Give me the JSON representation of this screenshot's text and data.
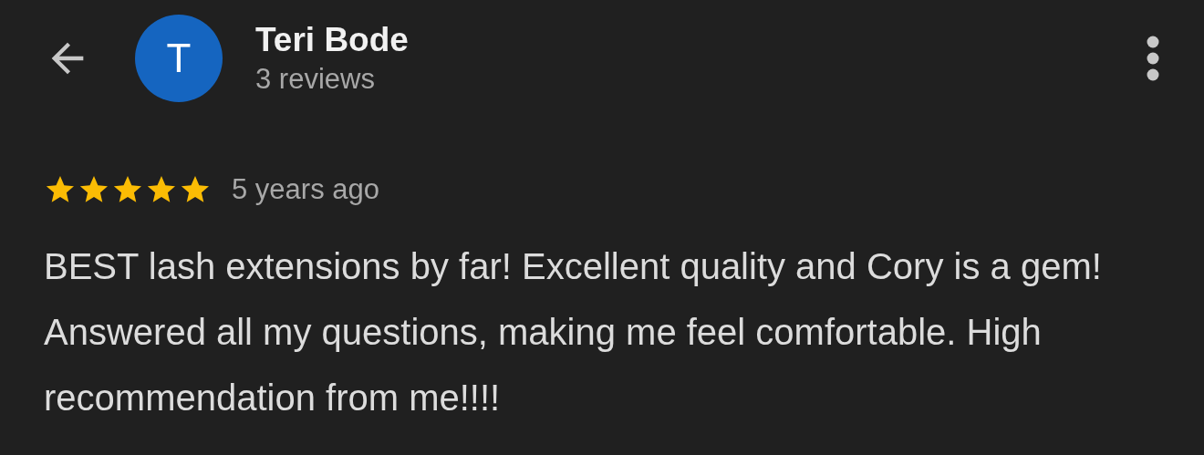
{
  "header": {
    "avatar_letter": "T",
    "name": "Teri Bode",
    "subtitle": "3 reviews"
  },
  "review": {
    "stars": 5,
    "time": "5 years ago",
    "text": "BEST lash extensions by far! Excellent quality and Cory is a gem! Answered all my questions, making me feel comfortable. High recommendation from me!!!!"
  }
}
